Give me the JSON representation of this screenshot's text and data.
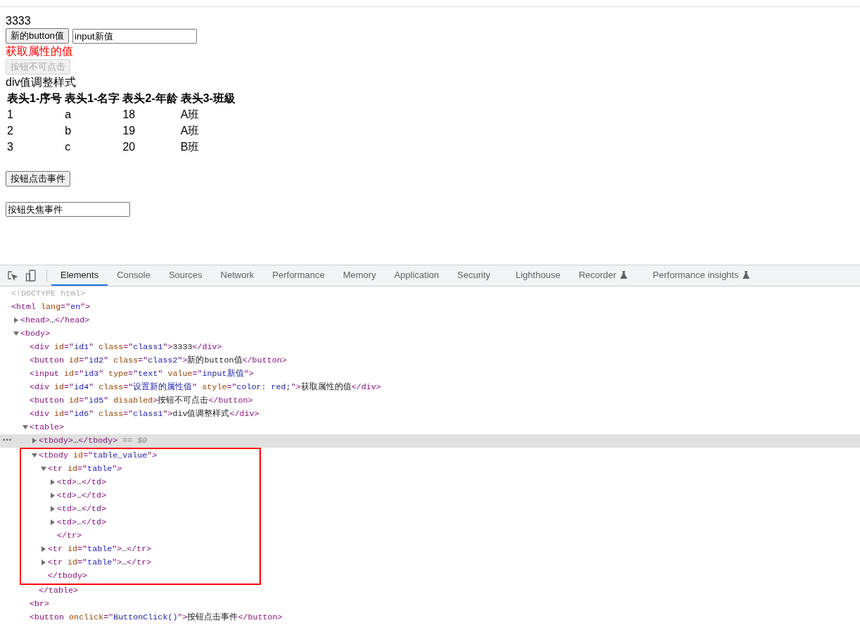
{
  "page": {
    "text_1": "3333",
    "button_1": {
      "label": "新的button值",
      "disabled": false
    },
    "input_1": {
      "value": "input新值"
    },
    "red_text": "获取属性的值",
    "button_2": {
      "label": "按钮不可点击",
      "disabled": true
    },
    "text_2": "div值调整样式",
    "table": {
      "columns": [
        "表头1-序号",
        "表头1-名字",
        "表头2-年龄",
        "表头3-班級"
      ],
      "rows": [
        [
          "1",
          "a",
          "18",
          "A班"
        ],
        [
          "2",
          "b",
          "19",
          "A班"
        ],
        [
          "3",
          "c",
          "20",
          "B班"
        ]
      ]
    },
    "button_3": {
      "label": "按钮点击事件",
      "disabled": false
    },
    "input_2": {
      "value": "按钮失焦事件"
    }
  },
  "devtools": {
    "tabs": [
      {
        "label": "Elements",
        "selected": true,
        "experimental": false
      },
      {
        "label": "Console",
        "selected": false,
        "experimental": false
      },
      {
        "label": "Sources",
        "selected": false,
        "experimental": false
      },
      {
        "label": "Network",
        "selected": false,
        "experimental": false
      },
      {
        "label": "Performance",
        "selected": false,
        "experimental": false
      },
      {
        "label": "Memory",
        "selected": false,
        "experimental": false
      },
      {
        "label": "Application",
        "selected": false,
        "experimental": false
      },
      {
        "label": "Security",
        "selected": false,
        "experimental": false
      },
      {
        "label": "Lighthouse",
        "selected": false,
        "experimental": false
      },
      {
        "label": "Recorder",
        "selected": false,
        "experimental": true
      },
      {
        "label": "Performance insights",
        "selected": false,
        "experimental": true
      }
    ],
    "dom_tree": [
      {
        "segments": [
          {
            "kind": "comment",
            "text": "<!DOCTYPE html>"
          }
        ]
      },
      {
        "segments": [
          {
            "kind": "tag",
            "text": "<html "
          },
          {
            "kind": "attr",
            "text": "lang"
          },
          {
            "kind": "tag",
            "text": "=\""
          },
          {
            "kind": "value",
            "text": "en"
          },
          {
            "kind": "tag",
            "text": "\">"
          }
        ],
        "children": [
          {
            "expanded": false,
            "segments": [
              {
                "kind": "tag",
                "text": "<head>"
              },
              {
                "kind": "text",
                "text": "…"
              },
              {
                "kind": "tag",
                "text": "</head>"
              }
            ]
          },
          {
            "expanded": true,
            "segments": [
              {
                "kind": "tag",
                "text": "<body>"
              }
            ],
            "children": [
              {
                "segments": [
                  {
                    "kind": "tag",
                    "text": "<div "
                  },
                  {
                    "kind": "attr",
                    "text": "id"
                  },
                  {
                    "kind": "tag",
                    "text": "=\""
                  },
                  {
                    "kind": "value",
                    "text": "id1"
                  },
                  {
                    "kind": "tag",
                    "text": "\" "
                  },
                  {
                    "kind": "attr",
                    "text": "class"
                  },
                  {
                    "kind": "tag",
                    "text": "=\""
                  },
                  {
                    "kind": "value",
                    "text": "class1"
                  },
                  {
                    "kind": "tag",
                    "text": "\">"
                  },
                  {
                    "kind": "text",
                    "text": "3333"
                  },
                  {
                    "kind": "tag",
                    "text": "</div>"
                  }
                ]
              },
              {
                "segments": [
                  {
                    "kind": "tag",
                    "text": "<button "
                  },
                  {
                    "kind": "attr",
                    "text": "id"
                  },
                  {
                    "kind": "tag",
                    "text": "=\""
                  },
                  {
                    "kind": "value",
                    "text": "id2"
                  },
                  {
                    "kind": "tag",
                    "text": "\" "
                  },
                  {
                    "kind": "attr",
                    "text": "class"
                  },
                  {
                    "kind": "tag",
                    "text": "=\""
                  },
                  {
                    "kind": "value",
                    "text": "class2"
                  },
                  {
                    "kind": "tag",
                    "text": "\">"
                  },
                  {
                    "kind": "text",
                    "text": "新的button值"
                  },
                  {
                    "kind": "tag",
                    "text": "</button>"
                  }
                ]
              },
              {
                "segments": [
                  {
                    "kind": "tag",
                    "text": "<input "
                  },
                  {
                    "kind": "attr",
                    "text": "id"
                  },
                  {
                    "kind": "tag",
                    "text": "=\""
                  },
                  {
                    "kind": "value",
                    "text": "id3"
                  },
                  {
                    "kind": "tag",
                    "text": "\" "
                  },
                  {
                    "kind": "attr",
                    "text": "type"
                  },
                  {
                    "kind": "tag",
                    "text": "=\""
                  },
                  {
                    "kind": "value",
                    "text": "text"
                  },
                  {
                    "kind": "tag",
                    "text": "\" "
                  },
                  {
                    "kind": "attr",
                    "text": "value"
                  },
                  {
                    "kind": "tag",
                    "text": "=\""
                  },
                  {
                    "kind": "value",
                    "text": "input新值"
                  },
                  {
                    "kind": "tag",
                    "text": "\">"
                  }
                ]
              },
              {
                "segments": [
                  {
                    "kind": "tag",
                    "text": "<div "
                  },
                  {
                    "kind": "attr",
                    "text": "id"
                  },
                  {
                    "kind": "tag",
                    "text": "=\""
                  },
                  {
                    "kind": "value",
                    "text": "id4"
                  },
                  {
                    "kind": "tag",
                    "text": "\" "
                  },
                  {
                    "kind": "attr",
                    "text": "class"
                  },
                  {
                    "kind": "tag",
                    "text": "=\""
                  },
                  {
                    "kind": "value",
                    "text": "设置新的属性值"
                  },
                  {
                    "kind": "tag",
                    "text": "\" "
                  },
                  {
                    "kind": "attr",
                    "text": "style"
                  },
                  {
                    "kind": "tag",
                    "text": "=\""
                  },
                  {
                    "kind": "value",
                    "text": "color: red;"
                  },
                  {
                    "kind": "tag",
                    "text": "\">"
                  },
                  {
                    "kind": "text",
                    "text": "获取属性的值"
                  },
                  {
                    "kind": "tag",
                    "text": "</div>"
                  }
                ]
              },
              {
                "segments": [
                  {
                    "kind": "tag",
                    "text": "<button "
                  },
                  {
                    "kind": "attr",
                    "text": "id"
                  },
                  {
                    "kind": "tag",
                    "text": "=\""
                  },
                  {
                    "kind": "value",
                    "text": "id5"
                  },
                  {
                    "kind": "tag",
                    "text": "\" "
                  },
                  {
                    "kind": "attr",
                    "text": "disabled"
                  },
                  {
                    "kind": "tag",
                    "text": ">"
                  },
                  {
                    "kind": "text",
                    "text": "按钮不可点击"
                  },
                  {
                    "kind": "tag",
                    "text": "</button>"
                  }
                ]
              },
              {
                "segments": [
                  {
                    "kind": "tag",
                    "text": "<div "
                  },
                  {
                    "kind": "attr",
                    "text": "id"
                  },
                  {
                    "kind": "tag",
                    "text": "=\""
                  },
                  {
                    "kind": "value",
                    "text": "id6"
                  },
                  {
                    "kind": "tag",
                    "text": "\" "
                  },
                  {
                    "kind": "attr",
                    "text": "class"
                  },
                  {
                    "kind": "tag",
                    "text": "=\""
                  },
                  {
                    "kind": "value",
                    "text": "class1"
                  },
                  {
                    "kind": "tag",
                    "text": "\">"
                  },
                  {
                    "kind": "text",
                    "text": "div值调整样式"
                  },
                  {
                    "kind": "tag",
                    "text": "</div>"
                  }
                ]
              },
              {
                "expanded": true,
                "segments": [
                  {
                    "kind": "tag",
                    "text": "<table>"
                  }
                ],
                "children": [
                  {
                    "expanded": false,
                    "selected": true,
                    "segments": [
                      {
                        "kind": "tag",
                        "text": "<tbody>"
                      },
                      {
                        "kind": "text",
                        "text": "…"
                      },
                      {
                        "kind": "tag",
                        "text": "</tbody>"
                      },
                      {
                        "kind": "hint",
                        "text": " == $0"
                      }
                    ],
                    "gutter": "•••"
                  },
                  {
                    "expanded": true,
                    "selected": false,
                    "highlighted": true,
                    "segments": [
                      {
                        "kind": "tag",
                        "text": "<tbody "
                      },
                      {
                        "kind": "attr",
                        "text": "id"
                      },
                      {
                        "kind": "tag",
                        "text": "=\""
                      },
                      {
                        "kind": "value",
                        "text": "table_value"
                      },
                      {
                        "kind": "tag",
                        "text": "\">"
                      }
                    ],
                    "children": [
                      {
                        "expanded": true,
                        "segments": [
                          {
                            "kind": "tag",
                            "text": "<tr "
                          },
                          {
                            "kind": "attr",
                            "text": "id"
                          },
                          {
                            "kind": "tag",
                            "text": "=\""
                          },
                          {
                            "kind": "value",
                            "text": "table"
                          },
                          {
                            "kind": "tag",
                            "text": "\">"
                          }
                        ],
                        "children": [
                          {
                            "expanded": false,
                            "segments": [
                              {
                                "kind": "tag",
                                "text": "<td>"
                              },
                              {
                                "kind": "text",
                                "text": "…"
                              },
                              {
                                "kind": "tag",
                                "text": "</td>"
                              }
                            ]
                          },
                          {
                            "expanded": false,
                            "segments": [
                              {
                                "kind": "tag",
                                "text": "<td>"
                              },
                              {
                                "kind": "text",
                                "text": "…"
                              },
                              {
                                "kind": "tag",
                                "text": "</td>"
                              }
                            ]
                          },
                          {
                            "expanded": false,
                            "segments": [
                              {
                                "kind": "tag",
                                "text": "<td>"
                              },
                              {
                                "kind": "text",
                                "text": "…"
                              },
                              {
                                "kind": "tag",
                                "text": "</td>"
                              }
                            ]
                          },
                          {
                            "expanded": false,
                            "segments": [
                              {
                                "kind": "tag",
                                "text": "<td>"
                              },
                              {
                                "kind": "text",
                                "text": "…"
                              },
                              {
                                "kind": "tag",
                                "text": "</td>"
                              }
                            ]
                          },
                          {
                            "segments": [
                              {
                                "kind": "tag",
                                "text": "</tr>"
                              }
                            ]
                          }
                        ]
                      },
                      {
                        "expanded": false,
                        "segments": [
                          {
                            "kind": "tag",
                            "text": "<tr "
                          },
                          {
                            "kind": "attr",
                            "text": "id"
                          },
                          {
                            "kind": "tag",
                            "text": "=\""
                          },
                          {
                            "kind": "value",
                            "text": "table"
                          },
                          {
                            "kind": "tag",
                            "text": "\">"
                          },
                          {
                            "kind": "text",
                            "text": "…"
                          },
                          {
                            "kind": "tag",
                            "text": "</tr>"
                          }
                        ]
                      },
                      {
                        "expanded": false,
                        "segments": [
                          {
                            "kind": "tag",
                            "text": "<tr "
                          },
                          {
                            "kind": "attr",
                            "text": "id"
                          },
                          {
                            "kind": "tag",
                            "text": "=\""
                          },
                          {
                            "kind": "value",
                            "text": "table"
                          },
                          {
                            "kind": "tag",
                            "text": "\">"
                          },
                          {
                            "kind": "text",
                            "text": "…"
                          },
                          {
                            "kind": "tag",
                            "text": "</tr>"
                          }
                        ]
                      },
                      {
                        "segments": [
                          {
                            "kind": "tag",
                            "text": "</tbody>"
                          }
                        ]
                      }
                    ]
                  },
                  {
                    "segments": [
                      {
                        "kind": "tag",
                        "text": "</table>"
                      }
                    ]
                  }
                ]
              },
              {
                "segments": [
                  {
                    "kind": "tag",
                    "text": "<br>"
                  }
                ]
              },
              {
                "segments": [
                  {
                    "kind": "tag",
                    "text": "<button "
                  },
                  {
                    "kind": "attr",
                    "text": "onclick"
                  },
                  {
                    "kind": "tag",
                    "text": "=\""
                  },
                  {
                    "kind": "value",
                    "text": "ButtonClick()"
                  },
                  {
                    "kind": "tag",
                    "text": "\">"
                  },
                  {
                    "kind": "text",
                    "text": "按钮点击事件"
                  },
                  {
                    "kind": "tag",
                    "text": "</button>"
                  }
                ]
              }
            ]
          }
        ]
      }
    ]
  }
}
